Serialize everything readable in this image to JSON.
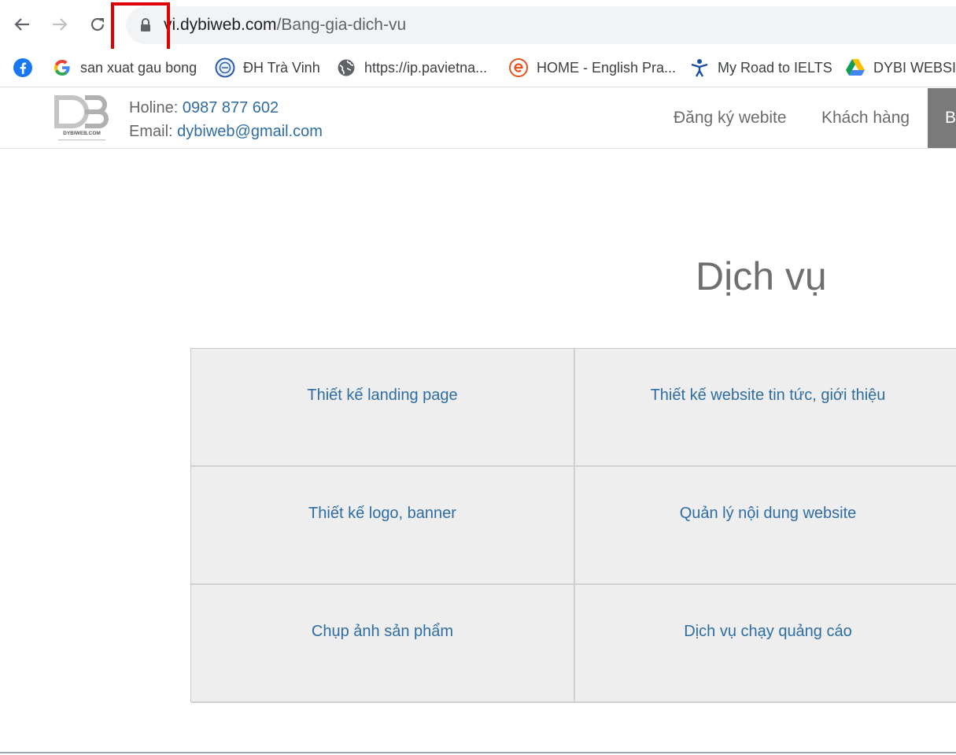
{
  "browser": {
    "url_host": "vi.dybiweb.com",
    "url_path": "/Bang-gia-dich-vu",
    "bookmarks": [
      {
        "label": "",
        "icon": "facebook-icon"
      },
      {
        "label": "san xuat gau bong",
        "icon": "google-icon"
      },
      {
        "label": "ĐH Trà Vinh",
        "icon": "tvu-icon"
      },
      {
        "label": "https://ip.pavietna...",
        "icon": "globe-icon"
      },
      {
        "label": "HOME - English Pra...",
        "icon": "e-icon"
      },
      {
        "label": "My Road to IELTS",
        "icon": "figure-icon"
      },
      {
        "label": "DYBI WEBSIT",
        "icon": "drive-icon"
      }
    ]
  },
  "site": {
    "logo_text": "DYBIWEB.COM",
    "hotline_label": "Holine:",
    "hotline_value": "0987 877 602",
    "email_label": "Email:",
    "email_value": "dybiweb@gmail.com",
    "menu": [
      "Đăng ký webite",
      "Khách hàng",
      "B"
    ]
  },
  "main": {
    "heading": "Dịch vụ",
    "services": [
      "Thiết kế landing page",
      "Thiết kế website tin tức, giới thiệu",
      "Thiết kế logo, banner",
      "Quản lý nội dung website",
      "Chụp ảnh sản phẩm",
      "Dịch vụ chạy quảng cáo"
    ]
  },
  "colors": {
    "link": "#2e6da4",
    "highlight_box": "#e00000",
    "cell_bg": "#eeeeee",
    "active_menu_bg": "#7a7a7a"
  }
}
